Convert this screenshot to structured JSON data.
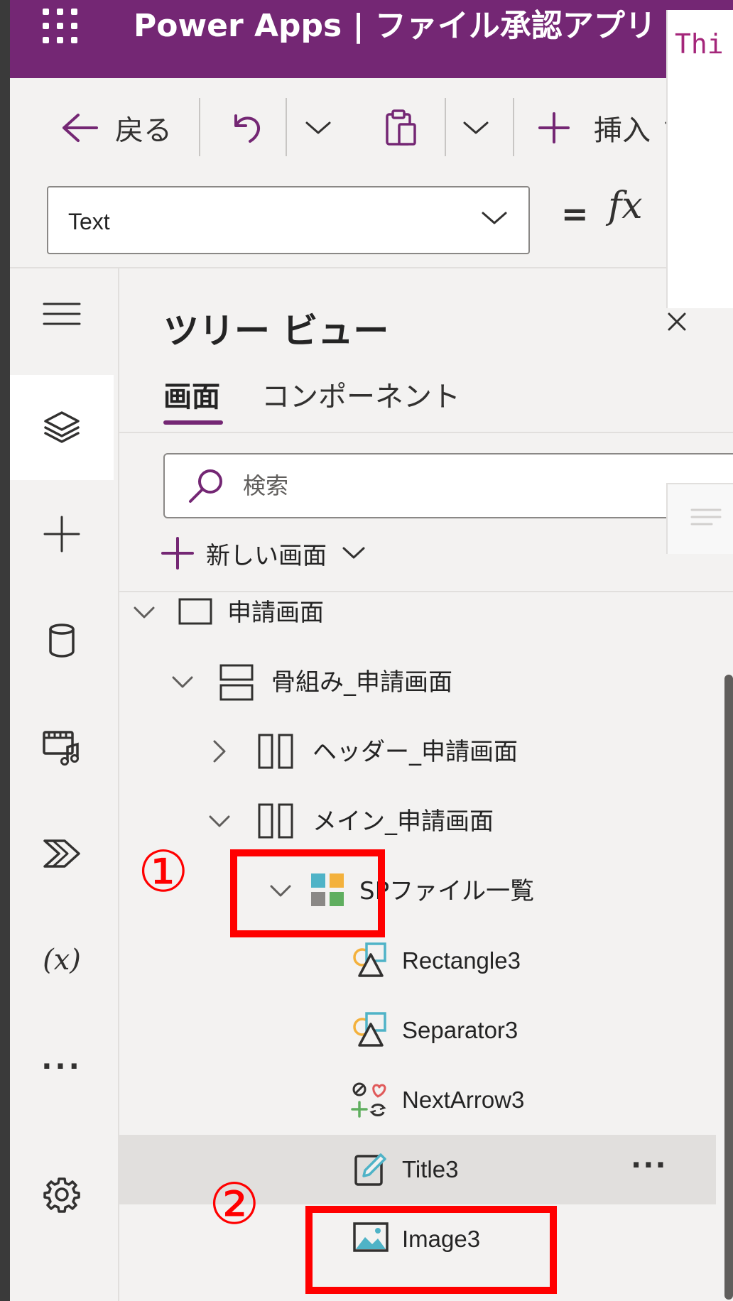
{
  "header": {
    "app_title": "Power Apps | ファイル承認アプリ"
  },
  "commandbar": {
    "back_label": "戻る",
    "insert_label": "挿入"
  },
  "formulabar": {
    "property": "Text",
    "equals": "=",
    "fx": "fx",
    "formula_text": "Thi"
  },
  "tree_panel": {
    "title": "ツリー ビュー",
    "tabs": [
      {
        "label": "画面",
        "selected": true
      },
      {
        "label": "コンポーネント",
        "selected": false
      }
    ],
    "search_placeholder": "検索",
    "new_screen_label": "新しい画面",
    "nodes": [
      {
        "label": "申請画面",
        "icon": "screen-icon",
        "expanded": true
      },
      {
        "label": "骨組み_申請画面",
        "icon": "vertical-container-icon",
        "expanded": true
      },
      {
        "label": "ヘッダー_申請画面",
        "icon": "horizontal-container-icon",
        "expanded": false
      },
      {
        "label": "メイン_申請画面",
        "icon": "horizontal-container-icon",
        "expanded": true
      },
      {
        "label": "SPファイル一覧",
        "icon": "gallery-icon",
        "expanded": true
      },
      {
        "label": "Rectangle3",
        "icon": "shape-icon"
      },
      {
        "label": "Separator3",
        "icon": "shape-icon"
      },
      {
        "label": "NextArrow3",
        "icon": "icons-icon"
      },
      {
        "label": "Title3",
        "icon": "label-edit-icon",
        "selected": true,
        "more": "···"
      },
      {
        "label": "Image3",
        "icon": "image-icon"
      }
    ]
  },
  "annotations": {
    "one": "①",
    "two": "②"
  },
  "colors": {
    "brand": "#742774",
    "annotation": "#ff0000",
    "formula_text": "#a4267a"
  }
}
